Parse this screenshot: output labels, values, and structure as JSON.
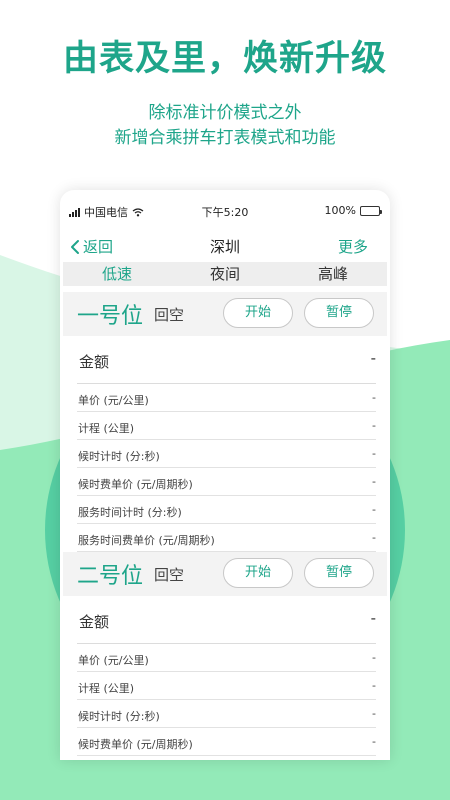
{
  "headline": "由表及里，焕新升级",
  "subtitle": [
    "除标准计价模式之外",
    "新增合乘拼车打表模式和功能"
  ],
  "colors": {
    "accent": "#1ea58a",
    "wave_light": "#d9f6e6",
    "wave_mid": "#93eab8",
    "circle": "#56cfa3"
  },
  "status_bar": {
    "carrier": "中国电信",
    "time": "下午5:20",
    "battery": "100%",
    "icons": [
      "signal-icon",
      "wifi-icon",
      "battery-icon"
    ]
  },
  "nav": {
    "back_label": "返回",
    "title": "深圳",
    "more_label": "更多"
  },
  "modes": [
    "低速",
    "夜间",
    "高峰"
  ],
  "active_mode": "低速",
  "slots": [
    {
      "name": "一号位",
      "status": "回空",
      "start_label": "开始",
      "pause_label": "暂停",
      "amount_label": "金额",
      "amount_value": "-",
      "rows": [
        {
          "label": "单价 (元/公里)",
          "value": "-"
        },
        {
          "label": "计程 (公里)",
          "value": "-"
        },
        {
          "label": "候时计时 (分:秒)",
          "value": "-"
        },
        {
          "label": "候时费单价 (元/周期秒)",
          "value": "-"
        },
        {
          "label": "服务时间计时 (分:秒)",
          "value": "-"
        },
        {
          "label": "服务时间费单价 (元/周期秒)",
          "value": "-"
        }
      ]
    },
    {
      "name": "二号位",
      "status": "回空",
      "start_label": "开始",
      "pause_label": "暂停",
      "amount_label": "金额",
      "amount_value": "-",
      "rows": [
        {
          "label": "单价 (元/公里)",
          "value": "-"
        },
        {
          "label": "计程 (公里)",
          "value": "-"
        },
        {
          "label": "候时计时 (分:秒)",
          "value": "-"
        },
        {
          "label": "候时费单价 (元/周期秒)",
          "value": "-"
        }
      ]
    }
  ]
}
